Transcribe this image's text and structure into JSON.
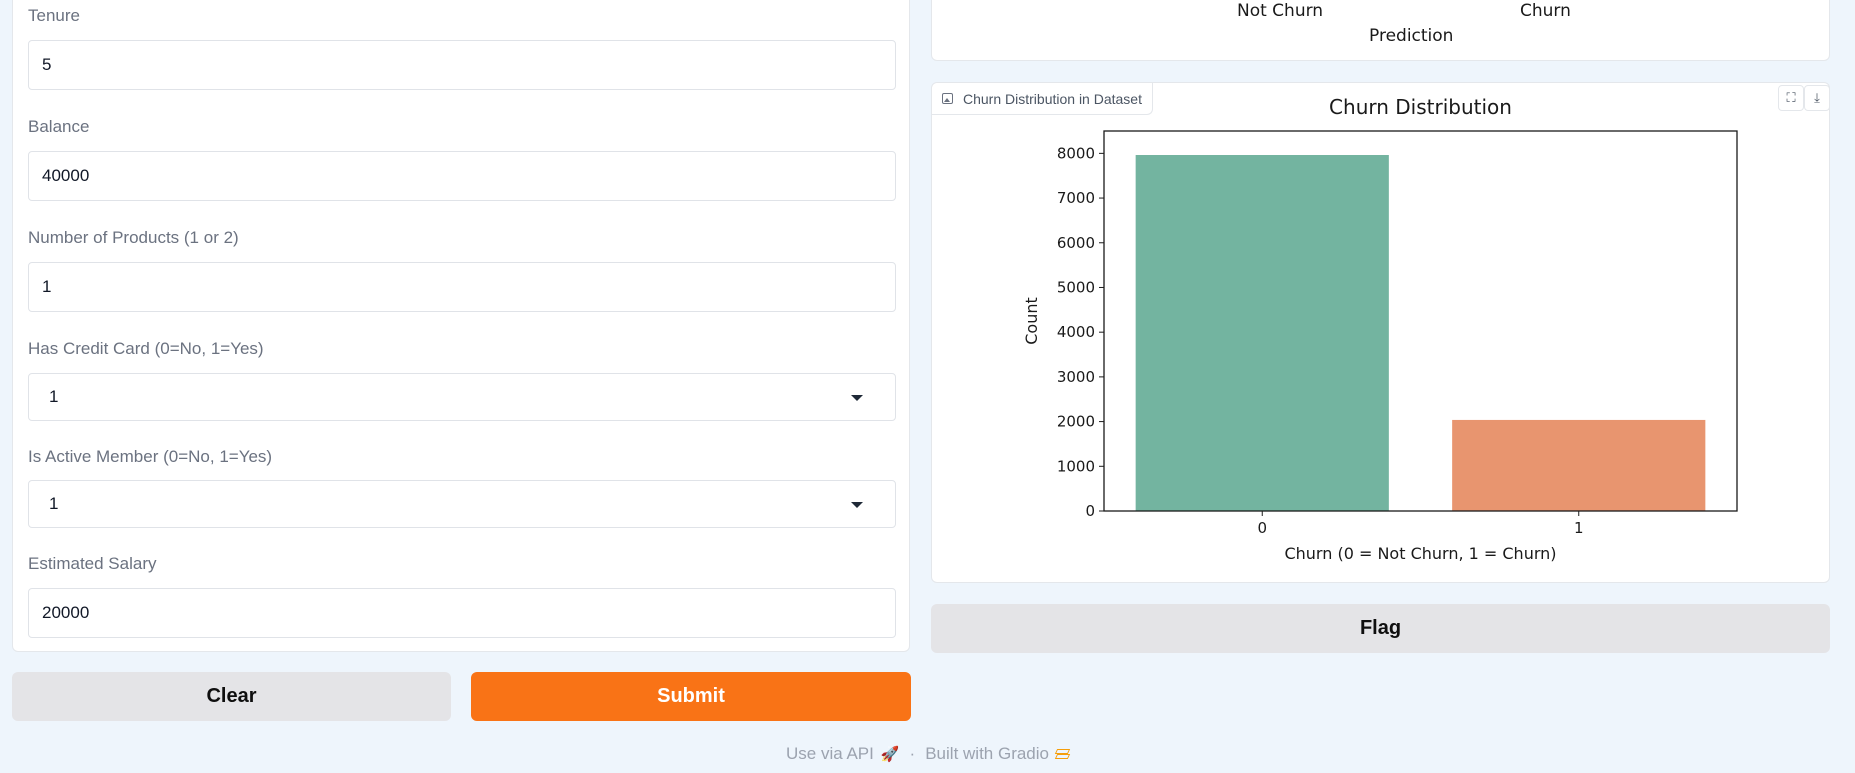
{
  "form": {
    "fields": [
      {
        "label": "Tenure",
        "value": "5"
      },
      {
        "label": "Balance",
        "value": "40000"
      },
      {
        "label": "Number of Products (1 or 2)",
        "value": "1"
      },
      {
        "label": "Has Credit Card (0=No, 1=Yes)",
        "value": "1"
      },
      {
        "label": "Is Active Member (0=No, 1=Yes)",
        "value": "1"
      },
      {
        "label": "Estimated Salary",
        "value": "20000"
      }
    ],
    "clear_label": "Clear",
    "submit_label": "Submit"
  },
  "prediction_plot": {
    "tick_labels": [
      "Not Churn",
      "Churn"
    ],
    "xlabel": "Prediction"
  },
  "chart_card": {
    "tag_label": "Churn Distribution in Dataset",
    "fullscreen_icon": "fullscreen-icon",
    "download_icon": "download-icon"
  },
  "chart_data": {
    "type": "bar",
    "title": "Churn Distribution",
    "categories": [
      "0",
      "1"
    ],
    "values": [
      7963,
      2037
    ],
    "xlabel": "Churn (0 = Not Churn, 1 = Churn)",
    "ylabel": "Count",
    "ylim": [
      0,
      8500
    ],
    "yticks": [
      0,
      1000,
      2000,
      3000,
      4000,
      5000,
      6000,
      7000,
      8000
    ],
    "colors": [
      "#73b4a0",
      "#e8956f"
    ],
    "grid": false
  },
  "flag_label": "Flag",
  "footer": {
    "api_label": "Use via API",
    "separator": "·",
    "built_label": "Built with Gradio"
  },
  "colors": {
    "background": "#eef5fc",
    "accent": "#f97316",
    "secondary_button": "#e4e4e7"
  }
}
